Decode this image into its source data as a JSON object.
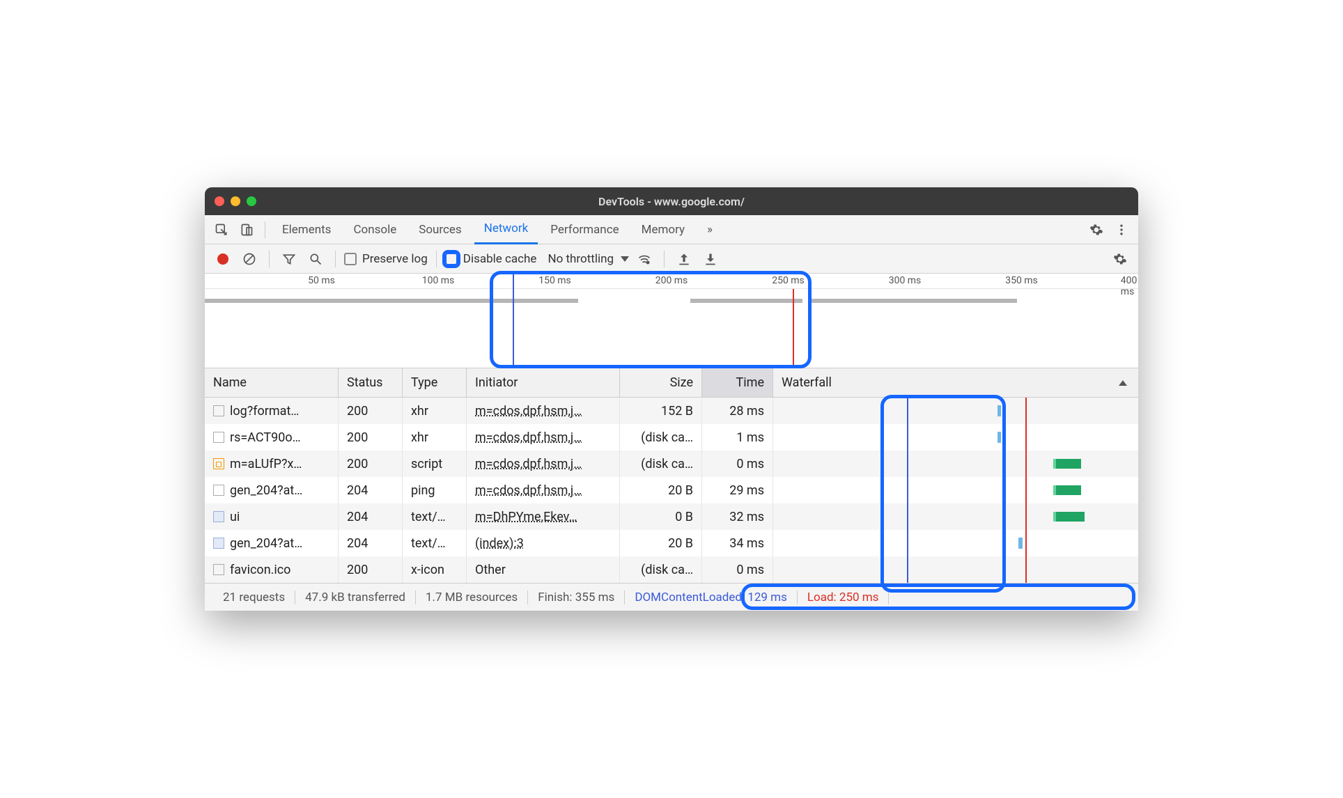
{
  "window": {
    "title": "DevTools - www.google.com/"
  },
  "tabs": {
    "items": [
      "Elements",
      "Console",
      "Sources",
      "Network",
      "Performance",
      "Memory"
    ],
    "more": "»",
    "activeIndex": 3
  },
  "toolbar": {
    "preserve_log": "Preserve log",
    "disable_cache": "Disable cache",
    "throttling": "No throttling"
  },
  "timeline": {
    "ticks": [
      "50 ms",
      "100 ms",
      "150 ms",
      "200 ms",
      "250 ms",
      "300 ms",
      "350 ms",
      "400 ms"
    ]
  },
  "columns": {
    "name": "Name",
    "status": "Status",
    "type": "Type",
    "initiator": "Initiator",
    "size": "Size",
    "time": "Time",
    "waterfall": "Waterfall"
  },
  "rows": [
    {
      "name": "log?format…",
      "status": "200",
      "type": "xhr",
      "initiator": "m=cdos,dpf,hsm,j…",
      "size": "152 B",
      "time": "28 ms",
      "icon": "plain"
    },
    {
      "name": "rs=ACT90o…",
      "status": "200",
      "type": "xhr",
      "initiator": "m=cdos,dpf,hsm,j…",
      "size": "(disk ca…",
      "time": "1 ms",
      "icon": "plain"
    },
    {
      "name": "m=aLUfP?x…",
      "status": "200",
      "type": "script",
      "initiator": "m=cdos,dpf,hsm,j…",
      "size": "(disk ca…",
      "time": "0 ms",
      "icon": "orange"
    },
    {
      "name": "gen_204?at…",
      "status": "204",
      "type": "ping",
      "initiator": "m=cdos,dpf,hsm,j…",
      "size": "20 B",
      "time": "29 ms",
      "icon": "plain"
    },
    {
      "name": "ui",
      "status": "204",
      "type": "text/…",
      "initiator": "m=DhPYme,Ekev…",
      "size": "0 B",
      "time": "32 ms",
      "icon": "doc"
    },
    {
      "name": "gen_204?at…",
      "status": "204",
      "type": "text/…",
      "initiator": "(index):3",
      "size": "20 B",
      "time": "34 ms",
      "icon": "doc"
    },
    {
      "name": "favicon.ico",
      "status": "200",
      "type": "x-icon",
      "initiator": "Other",
      "size": "(disk ca…",
      "time": "0 ms",
      "icon": "plain"
    }
  ],
  "status": {
    "requests": "21 requests",
    "transferred": "47.9 kB transferred",
    "resources": "1.7 MB resources",
    "finish": "Finish: 355 ms",
    "dcl": "DOMContentLoaded: 129 ms",
    "load": "Load: 250 ms"
  }
}
